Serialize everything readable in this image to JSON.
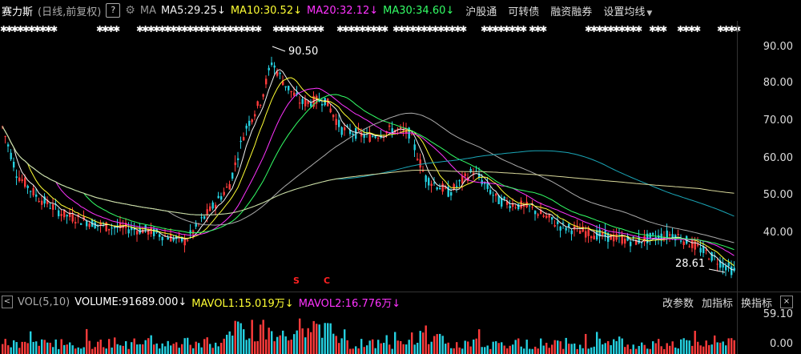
{
  "header": {
    "stock_name": "赛力斯",
    "mode": "(日线,前复权)",
    "help_label": "?",
    "ma_label": "MA",
    "ma5": "MA5:29.25↓",
    "ma10": "MA10:30.52↓",
    "ma20": "MA20:32.12↓",
    "ma30": "MA30:34.60↓",
    "menu": [
      "沪股通",
      "可转债",
      "融资融券",
      "设置均线"
    ],
    "colors": {
      "ma5": "#f0f0f0",
      "ma10": "#ffff33",
      "ma20": "#ff33ff",
      "ma30": "#33ff66",
      "up": "#ff3b3b",
      "down": "#25d0e0"
    }
  },
  "price_axis": {
    "ticks": [
      "90.00",
      "80.00",
      "70.00",
      "60.00",
      "50.00",
      "40.00"
    ]
  },
  "annotations": {
    "high": "90.50",
    "low": "28.61",
    "signal_s": "S",
    "signal_c": "C"
  },
  "volume_bar": {
    "left_btn": "<",
    "title": "VOL(5,10)",
    "volume": "VOLUME:91689.000↓",
    "mavol1": "MAVOL1:15.019万↓",
    "mavol2": "MAVOL2:16.776万↓",
    "menu": [
      "改参数",
      "加指标",
      "换指标"
    ],
    "close_btn": "×"
  },
  "volume_axis": {
    "ticks": [
      "59.10",
      "0.00"
    ]
  }
}
